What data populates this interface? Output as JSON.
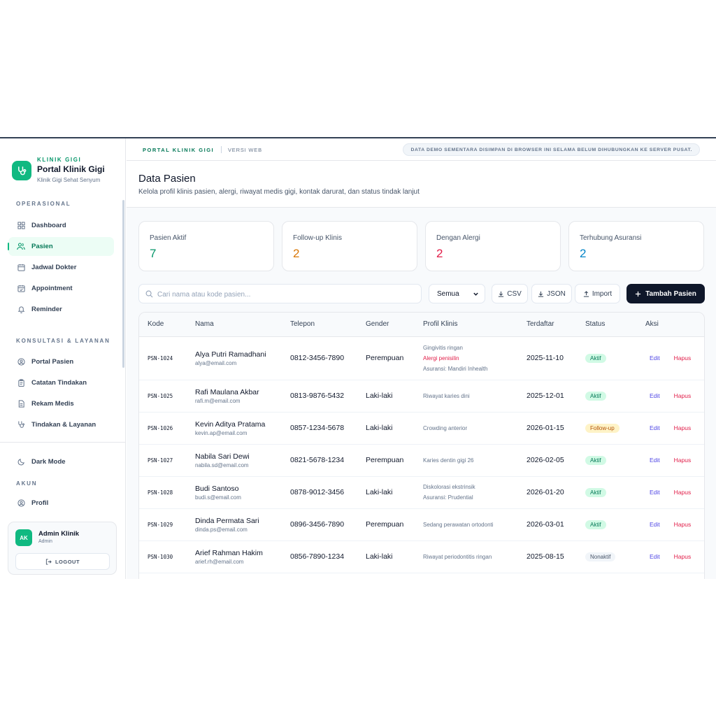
{
  "brand": {
    "kicker": "KLINIK GIGI",
    "title": "Portal Klinik Gigi",
    "subtitle": "Klinik Gigi Sehat Senyum"
  },
  "sidebar": {
    "section_operasional": "OPERASIONAL",
    "section_konsultasi": "KONSULTASI & LAYANAN",
    "section_akun": "AKUN",
    "items": [
      {
        "label": "Dashboard",
        "icon": "grid-icon"
      },
      {
        "label": "Pasien",
        "icon": "users-icon",
        "active": true
      },
      {
        "label": "Jadwal Dokter",
        "icon": "calendar-icon"
      },
      {
        "label": "Appointment",
        "icon": "calendar-check-icon"
      },
      {
        "label": "Reminder",
        "icon": "bell-icon"
      },
      {
        "label": "Portal Pasien",
        "icon": "user-circle-icon"
      },
      {
        "label": "Catatan Tindakan",
        "icon": "clipboard-icon"
      },
      {
        "label": "Rekam Medis",
        "icon": "file-text-icon"
      },
      {
        "label": "Tindakan & Layanan",
        "icon": "stethoscope-icon"
      },
      {
        "label": "Dark Mode",
        "icon": "moon-icon"
      },
      {
        "label": "Profil",
        "icon": "user-circle-icon"
      }
    ],
    "user": {
      "initials": "AK",
      "name": "Admin Klinik",
      "role": "Admin"
    },
    "logout": "LOGOUT"
  },
  "topbar": {
    "title": "PORTAL KLINIK GIGI",
    "version": "VERSI WEB",
    "note": "DATA DEMO SEMENTARA DISIMPAN DI BROWSER INI SELAMA BELUM DIHUBUNGKAN KE SERVER PUSAT."
  },
  "page": {
    "title": "Data Pasien",
    "subtitle": "Kelola profil klinis pasien, alergi, riwayat medis gigi, kontak darurat, dan status tindak lanjut"
  },
  "stats": [
    {
      "label": "Pasien Aktif",
      "value": "7",
      "color": "#059669"
    },
    {
      "label": "Follow-up Klinis",
      "value": "2",
      "color": "#d97706"
    },
    {
      "label": "Dengan Alergi",
      "value": "2",
      "color": "#e11d48"
    },
    {
      "label": "Terhubung Asuransi",
      "value": "2",
      "color": "#0284c7"
    }
  ],
  "toolbar": {
    "search_placeholder": "Cari nama atau kode pasien...",
    "filter_value": "Semua",
    "csv": "CSV",
    "json": "JSON",
    "import": "Import",
    "add": "Tambah Pasien"
  },
  "table": {
    "headers": [
      "Kode",
      "Nama",
      "Telepon",
      "Gender",
      "Profil Klinis",
      "Terdaftar",
      "Status",
      "Aksi"
    ],
    "edit_label": "Edit",
    "delete_label": "Hapus",
    "rows": [
      {
        "code": "PSN-1024",
        "name": "Alya Putri Ramadhani",
        "email": "alya@email.com",
        "phone": "0812-3456-7890",
        "gender": "Perempuan",
        "clinical": [
          "Gingivitis ringan"
        ],
        "allergy": "Alergi penisilin",
        "insurance": "Asuransi: Mandiri Inhealth",
        "date": "2025-11-10",
        "status": "Aktif",
        "status_kind": "green"
      },
      {
        "code": "PSN-1025",
        "name": "Rafi Maulana Akbar",
        "email": "rafi.m@email.com",
        "phone": "0813-9876-5432",
        "gender": "Laki-laki",
        "clinical": [
          "Riwayat karies dini"
        ],
        "date": "2025-12-01",
        "status": "Aktif",
        "status_kind": "green"
      },
      {
        "code": "PSN-1026",
        "name": "Kevin Aditya Pratama",
        "email": "kevin.ap@email.com",
        "phone": "0857-1234-5678",
        "gender": "Laki-laki",
        "clinical": [
          "Crowding anterior"
        ],
        "date": "2026-01-15",
        "status": "Follow-up",
        "status_kind": "amber"
      },
      {
        "code": "PSN-1027",
        "name": "Nabila Sari Dewi",
        "email": "nabila.sd@email.com",
        "phone": "0821-5678-1234",
        "gender": "Perempuan",
        "clinical": [
          "Karies dentin gigi 26"
        ],
        "date": "2026-02-05",
        "status": "Aktif",
        "status_kind": "green"
      },
      {
        "code": "PSN-1028",
        "name": "Budi Santoso",
        "email": "budi.s@email.com",
        "phone": "0878-9012-3456",
        "gender": "Laki-laki",
        "clinical": [
          "Diskolorasi ekstrinsik"
        ],
        "insurance": "Asuransi: Prudential",
        "date": "2026-01-20",
        "status": "Aktif",
        "status_kind": "green"
      },
      {
        "code": "PSN-1029",
        "name": "Dinda Permata Sari",
        "email": "dinda.ps@email.com",
        "phone": "0896-3456-7890",
        "gender": "Perempuan",
        "clinical": [
          "Sedang perawatan ortodonti"
        ],
        "date": "2026-03-01",
        "status": "Aktif",
        "status_kind": "green"
      },
      {
        "code": "PSN-1030",
        "name": "Arief Rahman Hakim",
        "email": "arief.rh@email.com",
        "phone": "0856-7890-1234",
        "gender": "Laki-laki",
        "clinical": [
          "Riwayat periodontitis ringan"
        ],
        "date": "2025-08-15",
        "status": "Nonaktif",
        "status_kind": "gray"
      }
    ]
  }
}
